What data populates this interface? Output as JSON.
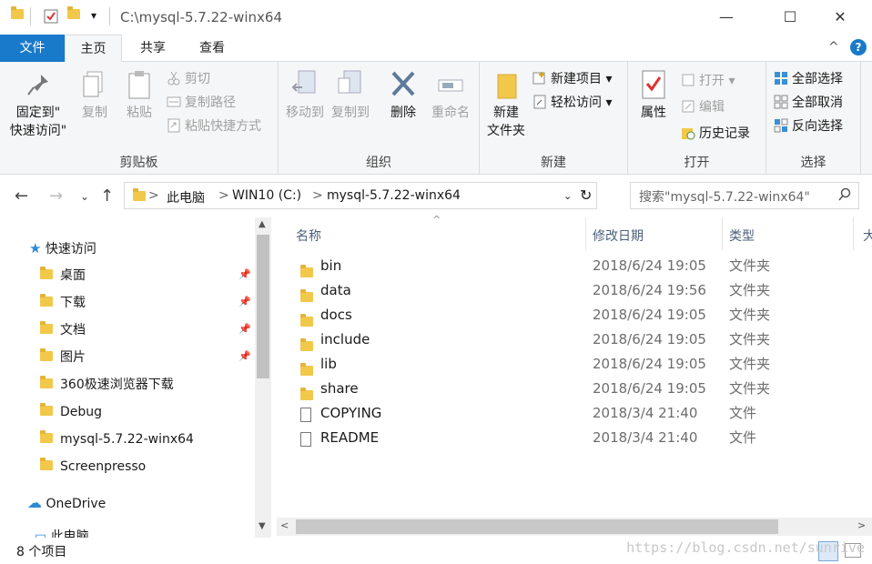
{
  "window": {
    "title": "C:\\mysql-5.7.22-winx64",
    "minimize_glyph": "—",
    "maximize_glyph": "☐",
    "close_glyph": "✕",
    "qa_dropdown_glyph": "▾"
  },
  "tabs": [
    {
      "label": "文件"
    },
    {
      "label": "主页"
    },
    {
      "label": "共享"
    },
    {
      "label": "查看"
    }
  ],
  "ribbon": {
    "collapse_glyph": "^",
    "help_glyph": "?",
    "clipboard": {
      "label": "剪贴板",
      "pin": "固定到\"",
      "pin2": "快速访问\"",
      "copy": "复制",
      "paste": "粘贴",
      "cut": "剪切",
      "copy_path": "复制路径",
      "paste_shortcut": "粘贴快捷方式"
    },
    "organize": {
      "label": "组织",
      "move_to": "移动到",
      "copy_to": "复制到",
      "delete": "删除",
      "rename": "重命名"
    },
    "new": {
      "label": "新建",
      "new_folder": "新建",
      "new_folder2": "文件夹",
      "new_item": "新建项目",
      "easy_access": "轻松访问"
    },
    "open": {
      "label": "打开",
      "properties": "属性",
      "open": "打开",
      "edit": "编辑",
      "history": "历史记录"
    },
    "select": {
      "label": "选择",
      "select_all": "全部选择",
      "select_none": "全部取消",
      "invert": "反向选择"
    }
  },
  "address": {
    "crumbs": [
      "此电脑",
      "WIN10 (C:)",
      "mysql-5.7.22-winx64"
    ],
    "separator": ">",
    "search_placeholder": "搜索\"mysql-5.7.22-winx64\""
  },
  "nav": {
    "quick_access": "快速访问",
    "items": [
      {
        "label": "桌面",
        "pinned": true
      },
      {
        "label": "下载",
        "pinned": true
      },
      {
        "label": "文档",
        "pinned": true
      },
      {
        "label": "图片",
        "pinned": true
      },
      {
        "label": "360极速浏览器下载",
        "pinned": false
      },
      {
        "label": "Debug",
        "pinned": false
      },
      {
        "label": "mysql-5.7.22-winx64",
        "pinned": false
      },
      {
        "label": "Screenpresso",
        "pinned": false
      }
    ],
    "onedrive": "OneDrive",
    "this_pc": "此电脑"
  },
  "columns": {
    "name": "名称",
    "date": "修改日期",
    "type": "类型",
    "size": "大"
  },
  "files": [
    {
      "name": "bin",
      "date": "2018/6/24 19:05",
      "type": "文件夹",
      "kind": "folder"
    },
    {
      "name": "data",
      "date": "2018/6/24 19:56",
      "type": "文件夹",
      "kind": "folder"
    },
    {
      "name": "docs",
      "date": "2018/6/24 19:05",
      "type": "文件夹",
      "kind": "folder"
    },
    {
      "name": "include",
      "date": "2018/6/24 19:05",
      "type": "文件夹",
      "kind": "folder"
    },
    {
      "name": "lib",
      "date": "2018/6/24 19:05",
      "type": "文件夹",
      "kind": "folder"
    },
    {
      "name": "share",
      "date": "2018/6/24 19:05",
      "type": "文件夹",
      "kind": "folder"
    },
    {
      "name": "COPYING",
      "date": "2018/3/4 21:40",
      "type": "文件",
      "kind": "file"
    },
    {
      "name": "README",
      "date": "2018/3/4 21:40",
      "type": "文件",
      "kind": "file"
    }
  ],
  "status": {
    "count": "8 个项目",
    "watermark": "https://blog.csdn.net/sunrive"
  },
  "colors": {
    "file_tab": "#1979ca",
    "folder": "#f2c84b",
    "header_text": "#4c607a"
  }
}
